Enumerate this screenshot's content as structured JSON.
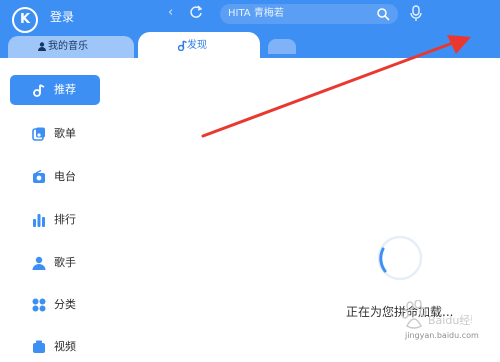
{
  "header": {
    "logo_letter": "K",
    "login_label": "登录",
    "search_placeholder": "HITA 青梅若",
    "accent_color": "#3e8ff4"
  },
  "tabs": [
    {
      "label": "我的音乐",
      "icon": "user-icon"
    },
    {
      "label": "发现",
      "icon": "music-note-icon",
      "active": true
    }
  ],
  "sidebar": {
    "items": [
      {
        "label": "推荐",
        "icon": "music-note-icon",
        "active": true
      },
      {
        "label": "歌单",
        "icon": "playlist-icon"
      },
      {
        "label": "电台",
        "icon": "radio-icon"
      },
      {
        "label": "排行",
        "icon": "chart-icon"
      },
      {
        "label": "歌手",
        "icon": "singer-icon"
      },
      {
        "label": "分类",
        "icon": "category-icon"
      },
      {
        "label": "视频",
        "icon": "video-icon"
      }
    ]
  },
  "main": {
    "loading_text": "正在为您拼命加载...",
    "watermark_text": "Baidu经验",
    "watermark_domain": "jingyan.baidu.com"
  },
  "annotation": {
    "arrow_color": "#e8382f"
  }
}
